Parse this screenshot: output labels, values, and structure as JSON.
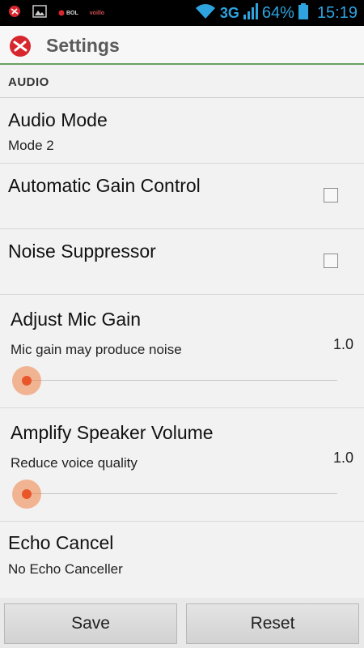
{
  "status_bar": {
    "left_icons": [
      "app-notification-icon",
      "image-icon",
      "app-badge-icon",
      "voip-app-icon"
    ],
    "badge_text": "BOL",
    "voip_text": "voillo",
    "network": "3G",
    "battery": "64%",
    "time": "15:19"
  },
  "action_bar": {
    "title": "Settings",
    "logo_color": "#d8262d"
  },
  "section": {
    "header": "AUDIO"
  },
  "items": {
    "audio_mode": {
      "title": "Audio Mode",
      "summary": "Mode 2"
    },
    "agc": {
      "title": "Automatic Gain Control",
      "checked": false
    },
    "noise": {
      "title": "Noise Suppressor",
      "checked": false
    },
    "mic_gain": {
      "title": "Adjust Mic Gain",
      "summary": "Mic gain may produce noise",
      "value": "1.0",
      "slider_fraction": 0.0
    },
    "speaker": {
      "title": "Amplify Speaker Volume",
      "summary": "Reduce voice quality",
      "value": "1.0",
      "slider_fraction": 0.0
    },
    "echo": {
      "title": "Echo Cancel",
      "summary": "No Echo Canceller"
    }
  },
  "buttons": {
    "save": "Save",
    "reset": "Reset"
  },
  "colors": {
    "accent": "#2ea3de",
    "divider_green": "#6aa063",
    "slider_thumb": "#e8562a"
  }
}
